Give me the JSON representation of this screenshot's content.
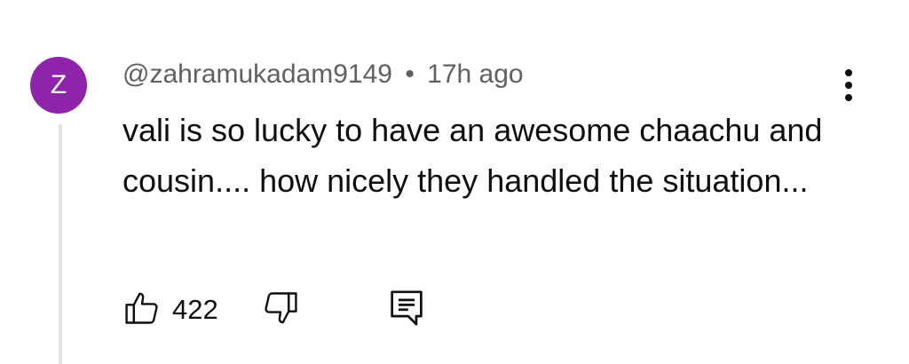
{
  "comment": {
    "avatar_letter": "Z",
    "avatar_color": "#8e24aa",
    "handle": "@zahramukadam9149",
    "separator": "•",
    "timestamp": "17h ago",
    "text": "vali is so lucky to have an awesome chaachu and cousin.... how nicely they handled the situation...",
    "like_count": "422",
    "icons": {
      "menu": "more-vertical-icon",
      "like": "thumbs-up-icon",
      "dislike": "thumbs-down-icon",
      "reply": "reply-comment-icon"
    }
  }
}
